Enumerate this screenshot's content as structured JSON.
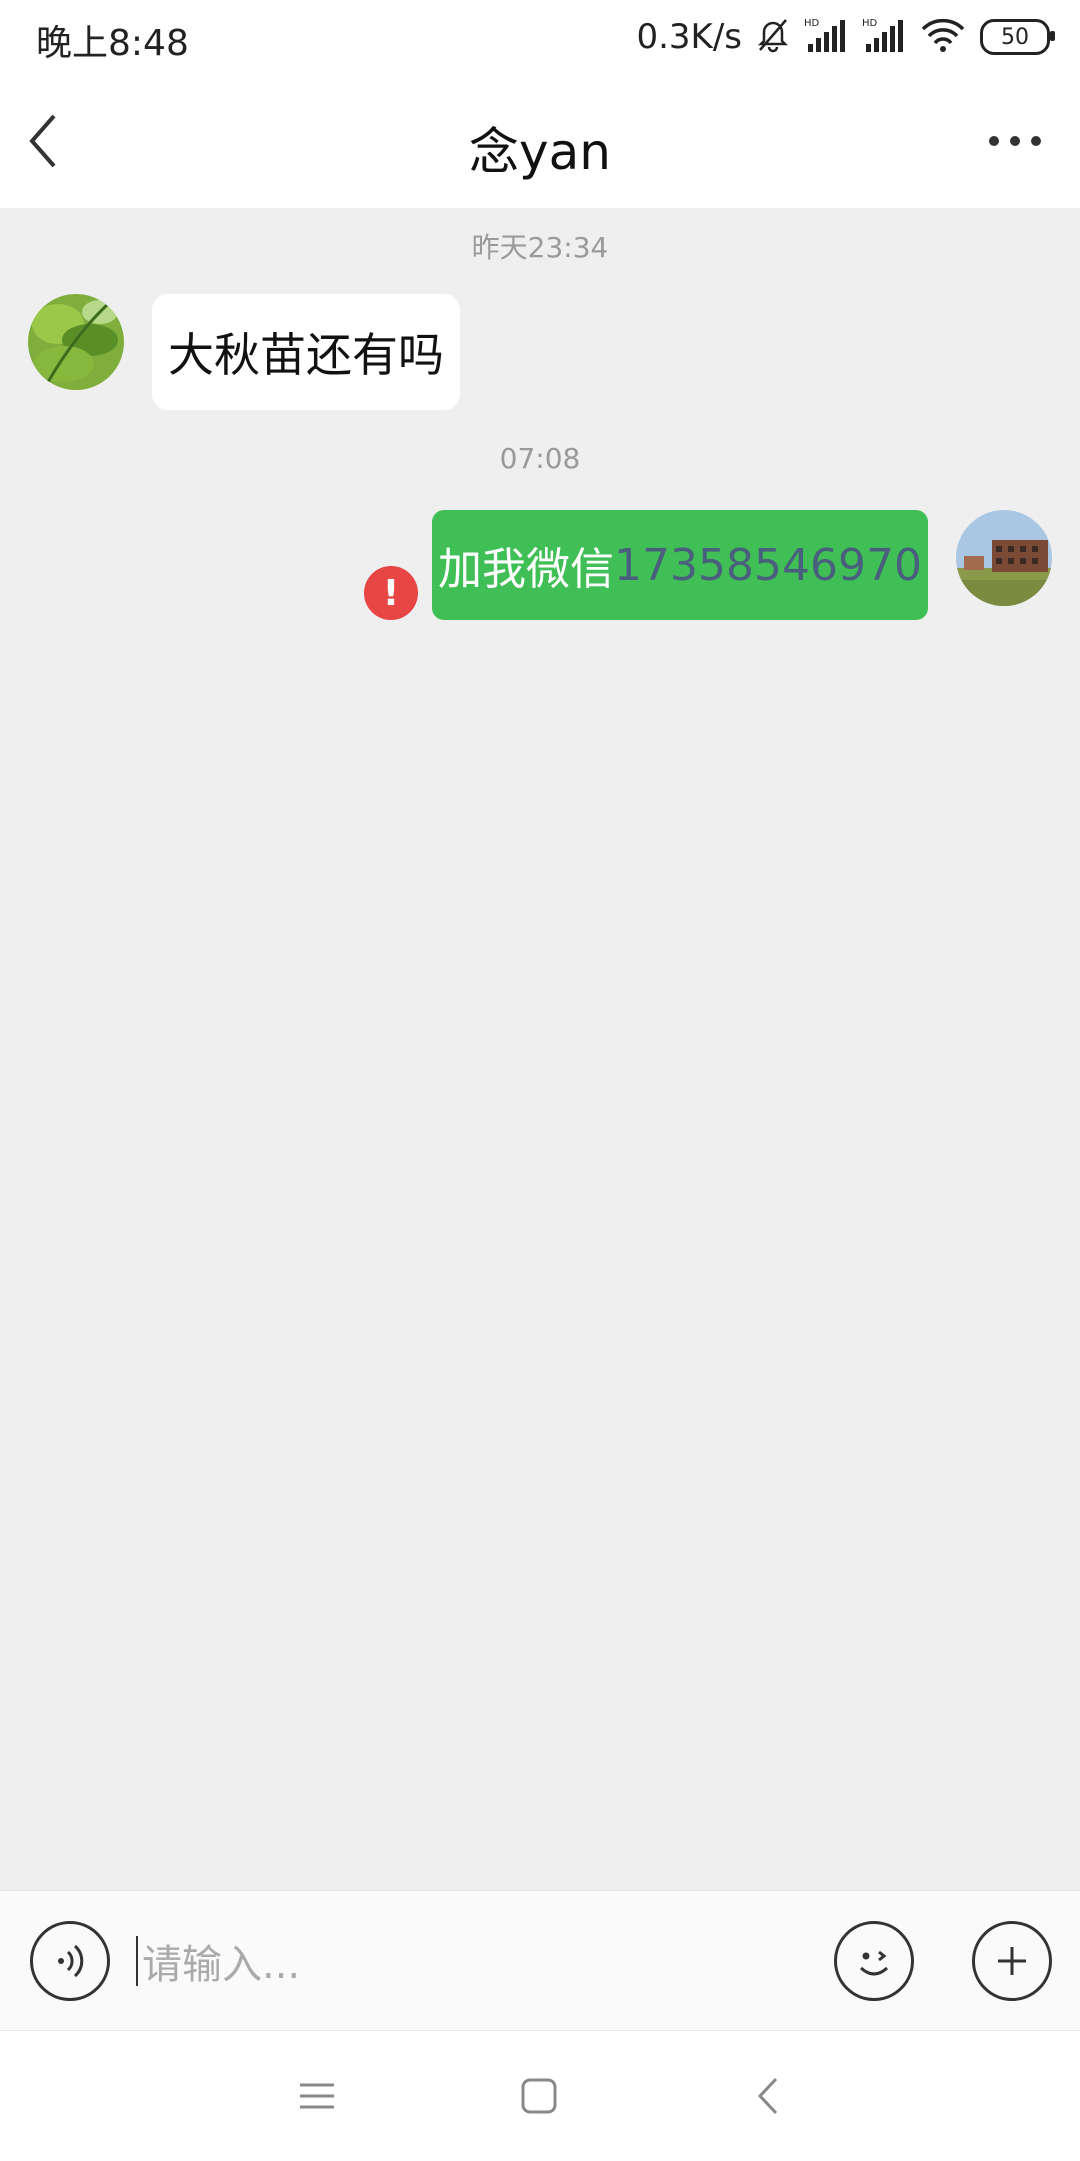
{
  "status_bar": {
    "time": "晚上8:48",
    "net_speed": "0.3K/s",
    "battery": "50",
    "signal_label": "HD"
  },
  "header": {
    "title": "念yan"
  },
  "messages": [
    {
      "timestamp": "昨天23:34",
      "direction": "incoming",
      "text": "大秋苗还有吗"
    },
    {
      "timestamp": "07:08",
      "direction": "outgoing",
      "text_prefix": "加我微信",
      "text_number": "17358546970",
      "send_failed": true
    }
  ],
  "input": {
    "placeholder": "请输入..."
  },
  "icons": {
    "back": "back-arrow-icon",
    "more": "more-dots-icon",
    "voice": "voice-icon",
    "emoji": "emoji-icon",
    "add": "plus-icon",
    "error": "exclamation-icon"
  },
  "colors": {
    "outgoing_bubble": "#3fbf55",
    "incoming_bubble": "#ffffff",
    "chat_background": "#efefef",
    "error": "#e84545",
    "phone_number": "#4a5f7e"
  }
}
